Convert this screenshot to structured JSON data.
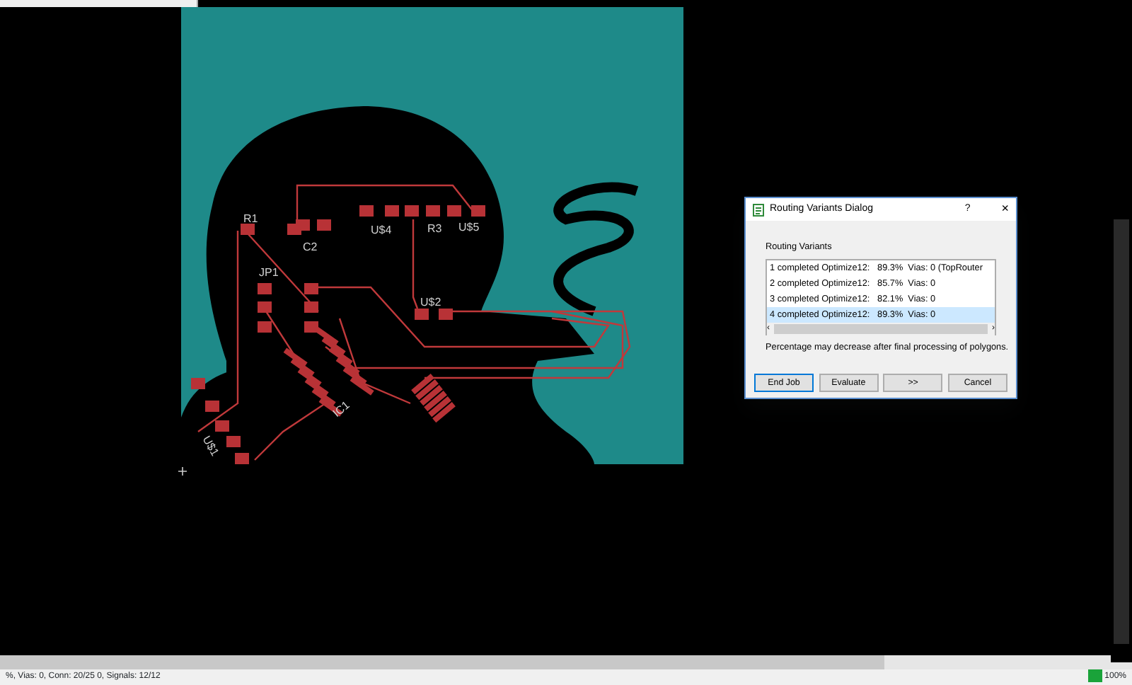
{
  "board": {
    "labels": [
      "R1",
      "C2",
      "U$4",
      "R3",
      "U$5",
      "JP1",
      "U$2",
      "IC1",
      "U$1"
    ]
  },
  "dialog": {
    "title": "Routing Variants Dialog",
    "help": "?",
    "close": "×",
    "group_label": "Routing Variants",
    "variants": [
      {
        "text": "1 completed Optimize12:   89.3%  Vias: 0 (TopRouter",
        "selected": false
      },
      {
        "text": "2 completed Optimize12:   85.7%  Vias: 0",
        "selected": false
      },
      {
        "text": "3 completed Optimize12:   82.1%  Vias: 0",
        "selected": false
      },
      {
        "text": "4 completed Optimize12:   89.3%  Vias: 0",
        "selected": true
      }
    ],
    "scroll_left": "‹",
    "scroll_right": "›",
    "note": "Percentage may decrease after final processing of polygons.",
    "buttons": [
      {
        "label": "End Job",
        "default": true
      },
      {
        "label": "Evaluate",
        "default": false
      },
      {
        "label": ">>",
        "default": false
      },
      {
        "label": "Cancel",
        "default": false
      }
    ]
  },
  "status_bar": {
    "text": "%, Vias: 0, Conn: 20/25 0, Signals: 12/12",
    "zoom": "100%"
  }
}
